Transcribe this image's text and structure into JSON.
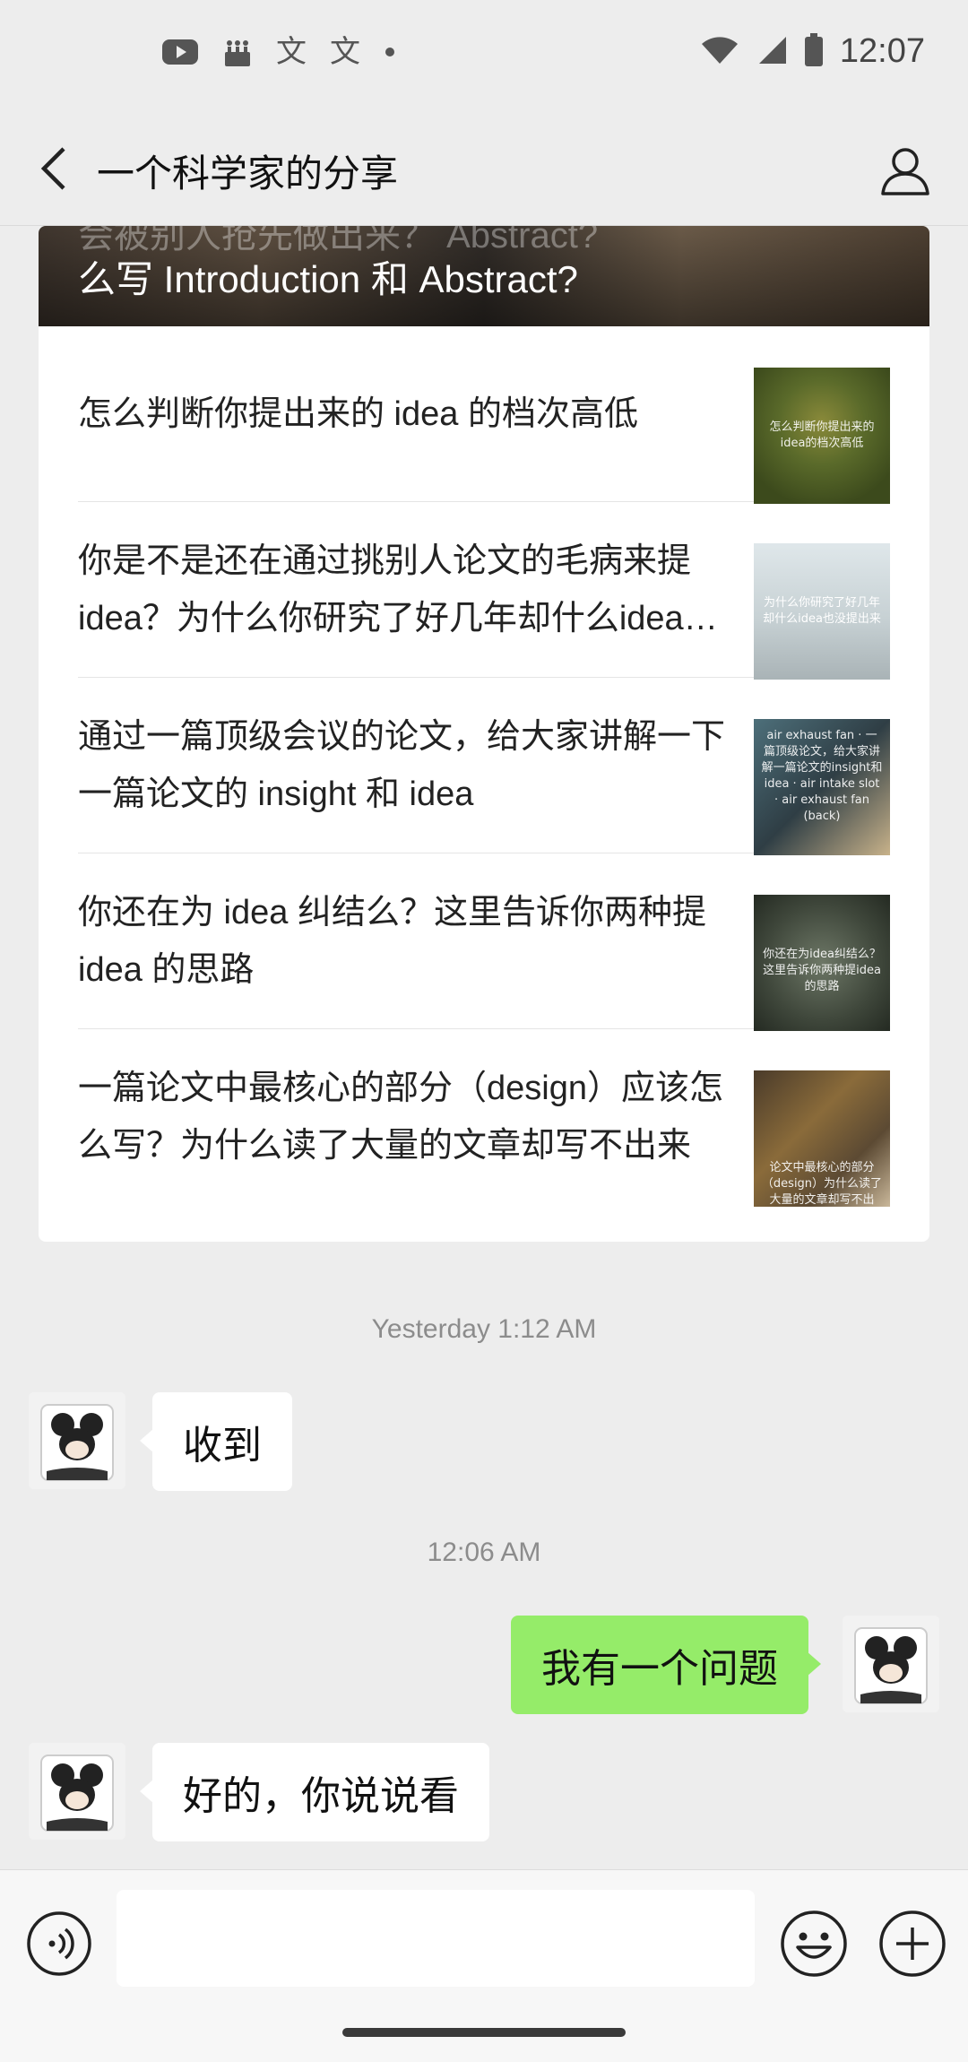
{
  "status_bar": {
    "time": "12:07",
    "notification_icons": [
      "youtube-icon",
      "cake-icon",
      "translate-icon",
      "translate-icon",
      "dot-icon"
    ],
    "system_icons": [
      "wifi-icon",
      "cellular-icon",
      "battery-icon"
    ]
  },
  "header": {
    "title": "一个科学家的分享"
  },
  "article_card": {
    "cover_title_partial": "会被别人抢先做出来？ Abstract?",
    "cover_title": "么写 Introduction 和 Abstract?",
    "items": [
      {
        "title": "怎么判断你提出来的 idea 的档次高低",
        "thumb_text": "怎么判断你提出来的idea的档次高低"
      },
      {
        "title": "你是不是还在通过挑别人论文的毛病来提 idea？为什么你研究了好几年却什么idea也没提出来",
        "thumb_text": "为什么你研究了好几年却什么idea也没提出来"
      },
      {
        "title": "通过一篇顶级会议的论文，给大家讲解一下一篇论文的 insight 和 idea",
        "thumb_text": "air exhaust fan · 一篇顶级论文，给大家讲解一篇论文的insight和idea · air intake slot · air exhaust fan (back)"
      },
      {
        "title": "你还在为 idea 纠结么？这里告诉你两种提 idea 的思路",
        "thumb_text": "你还在为idea纠结么？这里告诉你两种提idea的思路"
      },
      {
        "title": "一篇论文中最核心的部分（design）应该怎么写？为什么读了大量的文章却写不出来",
        "thumb_text": "论文中最核心的部分（design）为什么读了大量的文章却写不出"
      }
    ]
  },
  "messages": [
    {
      "type": "timestamp",
      "text": "Yesterday 1:12 AM"
    },
    {
      "type": "incoming",
      "text": "收到"
    },
    {
      "type": "timestamp",
      "text": "12:06 AM"
    },
    {
      "type": "outgoing",
      "text": "我有一个问题"
    },
    {
      "type": "incoming",
      "text": "好的，你说说看"
    }
  ],
  "input_bar": {
    "placeholder": "",
    "value": ""
  },
  "colors": {
    "background": "#EDEDED",
    "outgoing_bubble": "#95EC69",
    "incoming_bubble": "#FFFFFF",
    "timestamp_text": "#8C8C8C"
  }
}
